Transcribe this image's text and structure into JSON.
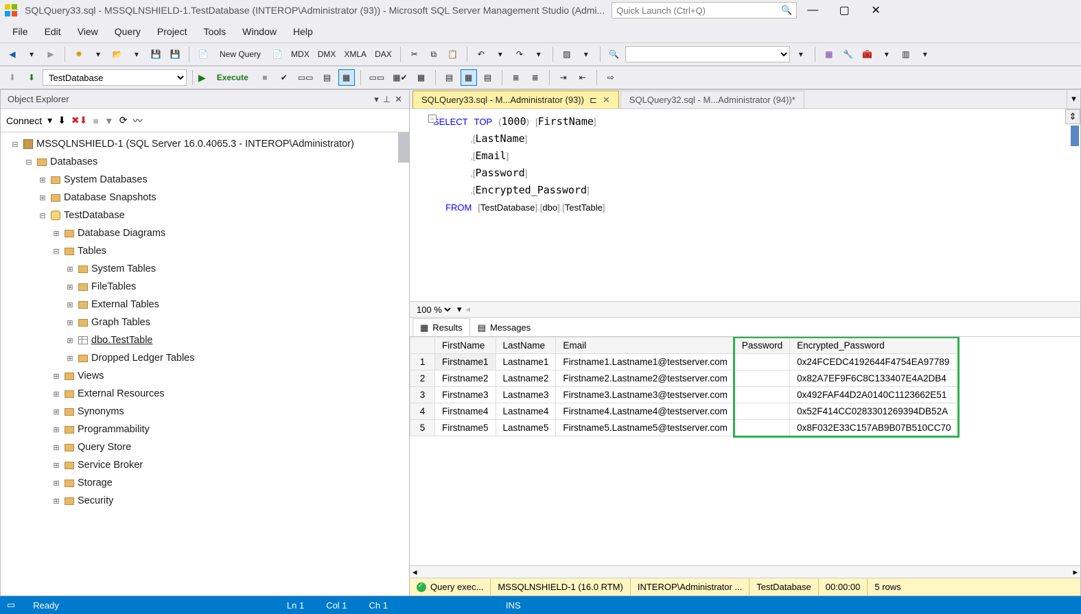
{
  "titlebar": {
    "title": "SQLQuery33.sql - MSSQLNSHIELD-1.TestDatabase (INTEROP\\Administrator (93)) - Microsoft SQL Server Management Studio (Admi...",
    "quick_launch_placeholder": "Quick Launch (Ctrl+Q)"
  },
  "menu": [
    "File",
    "Edit",
    "View",
    "Query",
    "Project",
    "Tools",
    "Window",
    "Help"
  ],
  "toolbar": {
    "new_query": "New Query",
    "db_selected": "TestDatabase",
    "execute": "Execute",
    "small_labels": [
      "MDX",
      "DMX",
      "XMLA",
      "DAX"
    ]
  },
  "object_explorer": {
    "title": "Object Explorer",
    "connect": "Connect",
    "server": "MSSQLNSHIELD-1 (SQL Server 16.0.4065.3 - INTEROP\\Administrator)",
    "tree": [
      {
        "indent": 0,
        "tgl": "⊟",
        "icon": "srv",
        "label": "MSSQLNSHIELD-1 (SQL Server 16.0.4065.3 - INTEROP\\Administrator)",
        "key": "server"
      },
      {
        "indent": 1,
        "tgl": "⊟",
        "icon": "folder",
        "label": "Databases",
        "key": "databases"
      },
      {
        "indent": 2,
        "tgl": "⊞",
        "icon": "folder",
        "label": "System Databases",
        "key": "sysdb"
      },
      {
        "indent": 2,
        "tgl": "⊞",
        "icon": "folder",
        "label": "Database Snapshots",
        "key": "snapshots"
      },
      {
        "indent": 2,
        "tgl": "⊟",
        "icon": "db",
        "label": "TestDatabase",
        "key": "testdb"
      },
      {
        "indent": 3,
        "tgl": "⊞",
        "icon": "folder",
        "label": "Database Diagrams",
        "key": "diagrams"
      },
      {
        "indent": 3,
        "tgl": "⊟",
        "icon": "folder",
        "label": "Tables",
        "key": "tables"
      },
      {
        "indent": 4,
        "tgl": "⊞",
        "icon": "folder",
        "label": "System Tables",
        "key": "systables"
      },
      {
        "indent": 4,
        "tgl": "⊞",
        "icon": "folder",
        "label": "FileTables",
        "key": "filetables"
      },
      {
        "indent": 4,
        "tgl": "⊞",
        "icon": "folder",
        "label": "External Tables",
        "key": "exttables"
      },
      {
        "indent": 4,
        "tgl": "⊞",
        "icon": "folder",
        "label": "Graph Tables",
        "key": "graphtables"
      },
      {
        "indent": 4,
        "tgl": "⊞",
        "icon": "table",
        "label": "dbo.TestTable",
        "key": "testtable",
        "underline": true
      },
      {
        "indent": 4,
        "tgl": "⊞",
        "icon": "folder",
        "label": "Dropped Ledger Tables",
        "key": "droppedledger"
      },
      {
        "indent": 3,
        "tgl": "⊞",
        "icon": "folder",
        "label": "Views",
        "key": "views"
      },
      {
        "indent": 3,
        "tgl": "⊞",
        "icon": "folder",
        "label": "External Resources",
        "key": "extres"
      },
      {
        "indent": 3,
        "tgl": "⊞",
        "icon": "folder",
        "label": "Synonyms",
        "key": "synonyms"
      },
      {
        "indent": 3,
        "tgl": "⊞",
        "icon": "folder",
        "label": "Programmability",
        "key": "prog"
      },
      {
        "indent": 3,
        "tgl": "⊞",
        "icon": "folder",
        "label": "Query Store",
        "key": "qstore"
      },
      {
        "indent": 3,
        "tgl": "⊞",
        "icon": "folder",
        "label": "Service Broker",
        "key": "broker"
      },
      {
        "indent": 3,
        "tgl": "⊞",
        "icon": "folder",
        "label": "Storage",
        "key": "storage"
      },
      {
        "indent": 3,
        "tgl": "⊞",
        "icon": "folder",
        "label": "Security",
        "key": "security"
      }
    ]
  },
  "tabs": [
    {
      "label": "SQLQuery33.sql - M...Administrator (93))",
      "active": true,
      "pin": true,
      "close": true
    },
    {
      "label": "SQLQuery32.sql - M...Administrator (94))*",
      "active": false
    }
  ],
  "sql_lines": [
    {
      "kind": "first"
    },
    {
      "field": "LastName"
    },
    {
      "field": "Email"
    },
    {
      "field": "Password"
    },
    {
      "field": "Encrypted_Password"
    },
    {
      "kind": "from"
    }
  ],
  "sql_first": {
    "select": "SELECT",
    "top": "TOP",
    "num": "1000",
    "col": "FirstName",
    "lb": "[",
    "rb": "]",
    "open": "(",
    "close": ")"
  },
  "sql_from": {
    "from": "FROM",
    "db": "TestDatabase",
    "schema": "dbo",
    "table": "TestTable",
    "lb": "[",
    "rb": "]",
    "dot": "."
  },
  "zoom": "100 %",
  "results": {
    "tabs": [
      "Results",
      "Messages"
    ],
    "columns": [
      "FirstName",
      "LastName",
      "Email",
      "Password",
      "Encrypted_Password"
    ],
    "rows": [
      [
        "Firstname1",
        "Lastname1",
        "Firstname1.Lastname1@testserver.com",
        "",
        "0x24FCEDC4192644F4754EA97789"
      ],
      [
        "Firstname2",
        "Lastname2",
        "Firstname2.Lastname2@testserver.com",
        "",
        "0x82A7EF9F6C8C133407E4A2DB4"
      ],
      [
        "Firstname3",
        "Lastname3",
        "Firstname3.Lastname3@testserver.com",
        "",
        "0x492FAF44D2A0140C1123662E51"
      ],
      [
        "Firstname4",
        "Lastname4",
        "Firstname4.Lastname4@testserver.com",
        "",
        "0x52F414CC0283301269394DB52A"
      ],
      [
        "Firstname5",
        "Lastname5",
        "Firstname5.Lastname5@testserver.com",
        "",
        "0x8F032E33C157AB9B07B510CC70"
      ]
    ]
  },
  "query_status": {
    "exec": "Query exec...",
    "server": "MSSQLNSHIELD-1 (16.0 RTM)",
    "user": "INTEROP\\Administrator ...",
    "db": "TestDatabase",
    "time": "00:00:00",
    "rows": "5 rows"
  },
  "statusbar": {
    "ready": "Ready",
    "ln": "Ln 1",
    "col": "Col 1",
    "ch": "Ch 1",
    "ins": "INS"
  }
}
